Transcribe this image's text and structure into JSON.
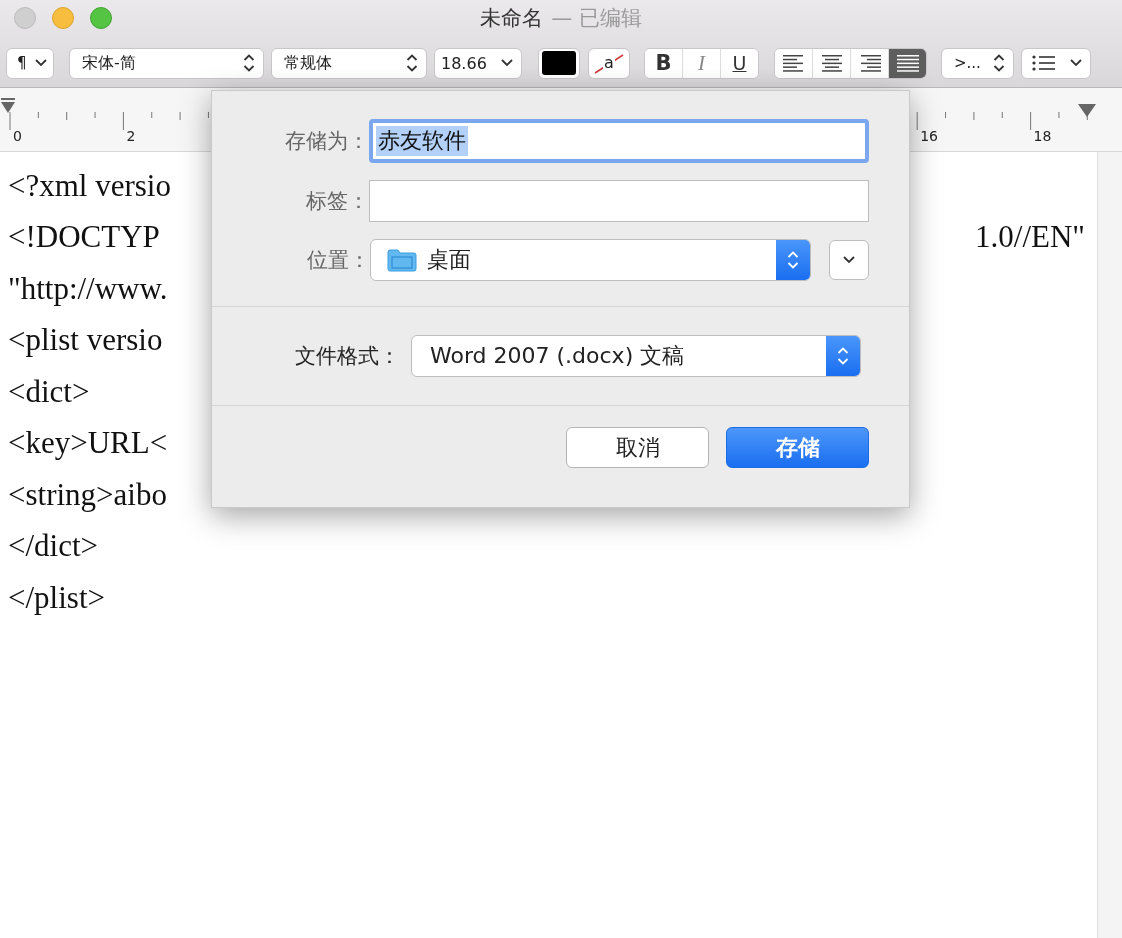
{
  "window": {
    "title": "未命名",
    "edited_suffix": "— 已编辑"
  },
  "toolbar": {
    "paragraph_style": "¶",
    "font_family": "宋体-简",
    "typeface": "常规体",
    "font_size": "18.66",
    "background_color_label": "a",
    "styles": [
      {
        "kind": "bold",
        "label": "B",
        "selected": false
      },
      {
        "kind": "italic",
        "label": "I",
        "selected": false
      },
      {
        "kind": "underline",
        "label": "U",
        "selected": false
      }
    ],
    "alignment": [
      {
        "kind": "left",
        "selected": false
      },
      {
        "kind": "center",
        "selected": false
      },
      {
        "kind": "right",
        "selected": false
      },
      {
        "kind": "justify",
        "selected": true
      }
    ],
    "spacing": ">..."
  },
  "ruler": {
    "labels": [
      "0",
      "2",
      "16",
      "18"
    ]
  },
  "document": {
    "lines": [
      {
        "left": "<?xml versio"
      },
      {
        "left": "<!DOCTYP",
        "right": "1.0//EN\""
      },
      {
        "left": "\"http://www."
      },
      {
        "left": "<plist versio"
      },
      {
        "left": "<dict>"
      },
      {
        "left": "<key>URL<"
      },
      {
        "left": "<string>aibo"
      },
      {
        "left": "</dict>"
      },
      {
        "left": "</plist>"
      }
    ]
  },
  "save_dialog": {
    "save_as": {
      "label": "存储为：",
      "value": "赤友软件",
      "selected": true,
      "focused": true
    },
    "tags": {
      "label": "标签："
    },
    "location": {
      "label": "位置：",
      "value": "桌面"
    },
    "file_format": {
      "label": "文件格式：",
      "value": "Word 2007 (.docx) 文稿"
    },
    "buttons": [
      {
        "label": "取消",
        "default": false
      },
      {
        "label": "存储",
        "default": true
      }
    ]
  }
}
